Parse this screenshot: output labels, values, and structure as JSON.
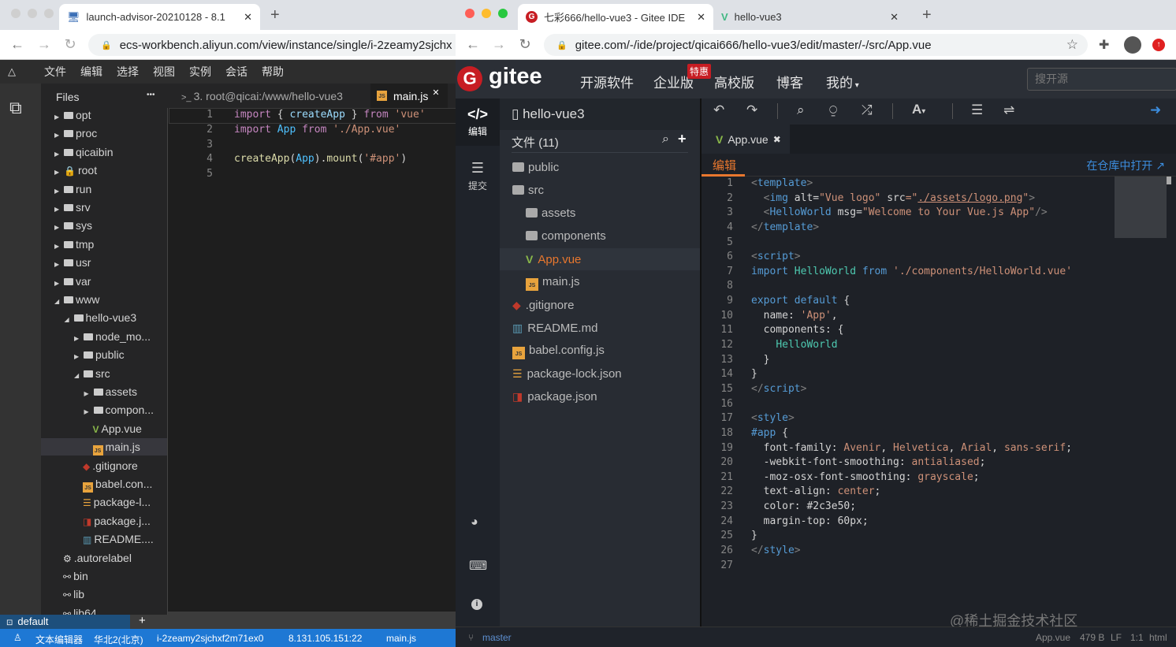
{
  "left_browser": {
    "tab_title": "launch-advisor-20210128 - 8.1",
    "url": "ecs-workbench.aliyun.com/view/instance/single/i-2zeamy2sjchx"
  },
  "left_app": {
    "menu": [
      "文件",
      "编辑",
      "选择",
      "视图",
      "实例",
      "会话",
      "帮助"
    ],
    "files_title": "Files",
    "more": "•••",
    "tree": [
      {
        "label": "opt",
        "lvl": 0,
        "type": "folder",
        "arrow": "right"
      },
      {
        "label": "proc",
        "lvl": 0,
        "type": "folder",
        "arrow": "right"
      },
      {
        "label": "qicaibin",
        "lvl": 0,
        "type": "folder",
        "arrow": "right"
      },
      {
        "label": "root",
        "lvl": 0,
        "type": "lock",
        "arrow": "right"
      },
      {
        "label": "run",
        "lvl": 0,
        "type": "folder",
        "arrow": "right"
      },
      {
        "label": "srv",
        "lvl": 0,
        "type": "folder",
        "arrow": "right"
      },
      {
        "label": "sys",
        "lvl": 0,
        "type": "folder",
        "arrow": "right"
      },
      {
        "label": "tmp",
        "lvl": 0,
        "type": "folder",
        "arrow": "right"
      },
      {
        "label": "usr",
        "lvl": 0,
        "type": "folder",
        "arrow": "right"
      },
      {
        "label": "var",
        "lvl": 0,
        "type": "folder",
        "arrow": "right"
      },
      {
        "label": "www",
        "lvl": 0,
        "type": "folder",
        "arrow": "down"
      },
      {
        "label": "hello-vue3",
        "lvl": 1,
        "type": "folder",
        "arrow": "down"
      },
      {
        "label": "node_mo...",
        "lvl": 2,
        "type": "folder",
        "arrow": "right"
      },
      {
        "label": "public",
        "lvl": 2,
        "type": "folder",
        "arrow": "right"
      },
      {
        "label": "src",
        "lvl": 2,
        "type": "folder",
        "arrow": "down"
      },
      {
        "label": "assets",
        "lvl": 3,
        "type": "folder",
        "arrow": "right"
      },
      {
        "label": "compon...",
        "lvl": 3,
        "type": "folder",
        "arrow": "right"
      },
      {
        "label": "App.vue",
        "lvl": 3,
        "type": "vue",
        "arrow": ""
      },
      {
        "label": "main.js",
        "lvl": 3,
        "type": "js",
        "arrow": "",
        "selected": true
      },
      {
        "label": ".gitignore",
        "lvl": 2,
        "type": "git",
        "arrow": ""
      },
      {
        "label": "babel.con...",
        "lvl": 2,
        "type": "js",
        "arrow": ""
      },
      {
        "label": "package-l...",
        "lvl": 2,
        "type": "lock-json",
        "arrow": ""
      },
      {
        "label": "package.j...",
        "lvl": 2,
        "type": "npm",
        "arrow": ""
      },
      {
        "label": "README....",
        "lvl": 2,
        "type": "md",
        "arrow": ""
      },
      {
        "label": ".autorelabel",
        "lvl": 0,
        "type": "gear",
        "arrow": ""
      },
      {
        "label": "bin",
        "lvl": 0,
        "type": "link",
        "arrow": ""
      },
      {
        "label": "lib",
        "lvl": 0,
        "type": "link",
        "arrow": ""
      },
      {
        "label": "lib64",
        "lvl": 0,
        "type": "link",
        "arrow": ""
      }
    ],
    "terminal_tab": "3. root@qicai:/www/hello-vue3",
    "editor_tab": "main.js",
    "code": [
      [
        [
          "import",
          "k-imp"
        ],
        [
          " { ",
          "k-p"
        ],
        [
          "createApp",
          "k-var"
        ],
        [
          " } ",
          "k-p"
        ],
        [
          "from",
          "k-imp"
        ],
        [
          " ",
          "k-p"
        ],
        [
          "'vue'",
          "k-str"
        ]
      ],
      [
        [
          "import",
          "k-imp"
        ],
        [
          " ",
          "k-p"
        ],
        [
          "App",
          "k-app"
        ],
        [
          " ",
          "k-p"
        ],
        [
          "from",
          "k-imp"
        ],
        [
          " ",
          "k-p"
        ],
        [
          "'./App.vue'",
          "k-str"
        ]
      ],
      [],
      [
        [
          "createApp",
          "k-fn"
        ],
        [
          "(",
          "k-p"
        ],
        [
          "App",
          "k-app"
        ],
        [
          ").",
          "k-p"
        ],
        [
          "mount",
          "k-fn"
        ],
        [
          "(",
          "k-p"
        ],
        [
          "'#app'",
          "k-str"
        ],
        [
          ")",
          "k-p"
        ]
      ],
      []
    ],
    "terminal_name": "default",
    "terminal_add": "+",
    "status": [
      "文本编辑器",
      "华北2(北京)",
      "i-2zeamy2sjchxf2m71ex0",
      "8.131.105.151:22",
      "main.js"
    ]
  },
  "right_browser": {
    "tab1_title": "七彩666/hello-vue3 - Gitee IDE",
    "tab2_title": "hello-vue3",
    "url": "gitee.com/-/ide/project/qicai666/hello-vue3/edit/master/-/src/App.vue"
  },
  "gitee": {
    "logo": "gitee",
    "nav": [
      "开源软件",
      "企业版",
      "高校版",
      "博客",
      "我的"
    ],
    "badge": "特惠",
    "search_placeholder": "搜开源",
    "side": {
      "edit": "编辑",
      "commit": "提交"
    },
    "repo": "hello-vue3",
    "files_label": "文件",
    "files_count": "(11)",
    "tree": [
      {
        "label": "public",
        "lvl": 0,
        "type": "folder"
      },
      {
        "label": "src",
        "lvl": 0,
        "type": "folder-open"
      },
      {
        "label": "assets",
        "lvl": 1,
        "type": "folder"
      },
      {
        "label": "components",
        "lvl": 1,
        "type": "folder"
      },
      {
        "label": "App.vue",
        "lvl": 1,
        "type": "vue",
        "selected": true
      },
      {
        "label": "main.js",
        "lvl": 1,
        "type": "js"
      },
      {
        "label": ".gitignore",
        "lvl": 0,
        "type": "git"
      },
      {
        "label": "README.md",
        "lvl": 0,
        "type": "md"
      },
      {
        "label": "babel.config.js",
        "lvl": 0,
        "type": "js"
      },
      {
        "label": "package-lock.json",
        "lvl": 0,
        "type": "lock-json"
      },
      {
        "label": "package.json",
        "lvl": 0,
        "type": "npm"
      }
    ],
    "editor_tab": "App.vue",
    "mode_tab": "编辑",
    "open_in_repo": "在仓库中打开",
    "code": [
      [
        [
          "<",
          "k-b"
        ],
        [
          "template",
          "k-tag"
        ],
        [
          ">",
          "k-b"
        ]
      ],
      [
        [
          "  <",
          "k-b"
        ],
        [
          "img",
          "k-tag"
        ],
        [
          " alt",
          "k-attr"
        ],
        [
          "=",
          "k-p"
        ],
        [
          "\"Vue logo\"",
          "k-val"
        ],
        [
          " src",
          "k-attr"
        ],
        [
          "=\"",
          "k-val"
        ],
        [
          "./assets/logo.png",
          "k-u"
        ],
        [
          "\"",
          "k-val"
        ],
        [
          ">",
          "k-b"
        ]
      ],
      [
        [
          "  <",
          "k-b"
        ],
        [
          "HelloWorld",
          "k-tag"
        ],
        [
          " msg",
          "k-attr"
        ],
        [
          "=",
          "k-p"
        ],
        [
          "\"Welcome to Your Vue.js App\"",
          "k-val"
        ],
        [
          "/>",
          "k-b"
        ]
      ],
      [
        [
          "</",
          "k-b"
        ],
        [
          "template",
          "k-tag"
        ],
        [
          ">",
          "k-b"
        ]
      ],
      [],
      [
        [
          "<",
          "k-b"
        ],
        [
          "script",
          "k-tag"
        ],
        [
          ">",
          "k-b"
        ]
      ],
      [
        [
          "import",
          "k-kw"
        ],
        [
          " ",
          "k-p"
        ],
        [
          "HelloWorld",
          "k-cls"
        ],
        [
          " ",
          "k-p"
        ],
        [
          "from",
          "k-kw"
        ],
        [
          " ",
          "k-p"
        ],
        [
          "'./components/HelloWorld.vue'",
          "k-str"
        ]
      ],
      [],
      [
        [
          "export",
          "k-kw"
        ],
        [
          " ",
          "k-p"
        ],
        [
          "default",
          "k-kw"
        ],
        [
          " {",
          "k-p"
        ]
      ],
      [
        [
          "  name: ",
          "k-p"
        ],
        [
          "'App'",
          "k-str"
        ],
        [
          ",",
          "k-p"
        ]
      ],
      [
        [
          "  components: {",
          "k-p"
        ]
      ],
      [
        [
          "    ",
          "k-p"
        ],
        [
          "HelloWorld",
          "k-cls"
        ]
      ],
      [
        [
          "  }",
          "k-p"
        ]
      ],
      [
        [
          "}",
          "k-p"
        ]
      ],
      [
        [
          "</",
          "k-b"
        ],
        [
          "script",
          "k-tag"
        ],
        [
          ">",
          "k-b"
        ]
      ],
      [],
      [
        [
          "<",
          "k-b"
        ],
        [
          "style",
          "k-tag"
        ],
        [
          ">",
          "k-b"
        ]
      ],
      [
        [
          "#app",
          "k-sel"
        ],
        [
          " {",
          "k-p"
        ]
      ],
      [
        [
          "  font-family: ",
          "k-p"
        ],
        [
          "Avenir",
          "k-val"
        ],
        [
          ", ",
          "k-p"
        ],
        [
          "Helvetica",
          "k-val"
        ],
        [
          ", ",
          "k-p"
        ],
        [
          "Arial",
          "k-val"
        ],
        [
          ", ",
          "k-p"
        ],
        [
          "sans-serif",
          "k-val"
        ],
        [
          ";",
          "k-p"
        ]
      ],
      [
        [
          "  -webkit-font-smoothing: ",
          "k-p"
        ],
        [
          "antialiased",
          "k-val"
        ],
        [
          ";",
          "k-p"
        ]
      ],
      [
        [
          "  -moz-osx-font-smoothing: ",
          "k-p"
        ],
        [
          "grayscale",
          "k-val"
        ],
        [
          ";",
          "k-p"
        ]
      ],
      [
        [
          "  text-align: ",
          "k-p"
        ],
        [
          "center",
          "k-val"
        ],
        [
          ";",
          "k-p"
        ]
      ],
      [
        [
          "  color: #2c3e50;",
          "k-p"
        ]
      ],
      [
        [
          "  margin-top: 60px;",
          "k-p"
        ]
      ],
      [
        [
          "}",
          "k-p"
        ]
      ],
      [
        [
          "</",
          "k-b"
        ],
        [
          "style",
          "k-tag"
        ],
        [
          ">",
          "k-b"
        ]
      ],
      []
    ],
    "branch": "master",
    "status_right": [
      "App.vue",
      "479 B",
      "LF",
      "1:1",
      "html"
    ],
    "watermark": "@稀土掘金技术社区"
  },
  "colors": {
    "gitee_red": "#c71d23",
    "accent_orange": "#e8772e",
    "status_blue": "#1e78d4",
    "link_blue": "#3c8dde"
  }
}
